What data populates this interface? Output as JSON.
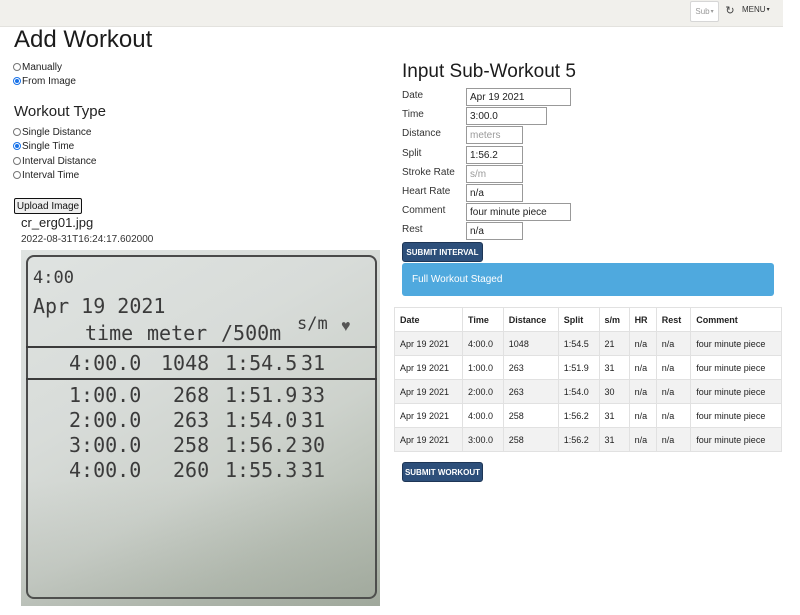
{
  "topbar": {
    "sub_dropdown": "Sub",
    "refresh_icon": "refresh-icon",
    "menu_label": "MENU"
  },
  "page": {
    "title": "Add Workout",
    "source_options": [
      {
        "label": "Manually",
        "selected": false
      },
      {
        "label": "From Image",
        "selected": true
      }
    ],
    "workout_type_heading": "Workout Type",
    "workout_types": [
      {
        "label": "Single Distance",
        "selected": false
      },
      {
        "label": "Single Time",
        "selected": true
      },
      {
        "label": "Interval Distance",
        "selected": false
      },
      {
        "label": "Interval Time",
        "selected": false
      }
    ],
    "upload_button": "Upload Image",
    "file_name": "cr_erg01.jpg",
    "file_timestamp": "2022-08-31T16:24:17.602000"
  },
  "erg_photo": {
    "top_time": "4:00",
    "date": "Apr  19 2021",
    "headers": [
      "time",
      "meter",
      "/500m",
      "s/m"
    ],
    "summary": [
      "4:00.0",
      "1048",
      "1:54.5",
      "31"
    ],
    "rows": [
      [
        "1:00.0",
        "268",
        "1:51.9",
        "33"
      ],
      [
        "2:00.0",
        "263",
        "1:54.0",
        "31"
      ],
      [
        "3:00.0",
        "258",
        "1:56.2",
        "30"
      ],
      [
        "4:00.0",
        "260",
        "1:55.3",
        "31"
      ]
    ]
  },
  "form": {
    "heading": "Input Sub-Workout 5",
    "fields": {
      "date": {
        "label": "Date",
        "value": "Apr 19 2021"
      },
      "time": {
        "label": "Time",
        "value": "3:00.0"
      },
      "distance": {
        "label": "Distance",
        "placeholder": "meters"
      },
      "split": {
        "label": "Split",
        "value": "1:56.2"
      },
      "stroke_rate": {
        "label": "Stroke Rate",
        "placeholder": "s/m"
      },
      "heart_rate": {
        "label": "Heart Rate",
        "value": "n/a"
      },
      "comment": {
        "label": "Comment",
        "value": "four minute piece"
      },
      "rest": {
        "label": "Rest",
        "value": "n/a"
      }
    },
    "submit_interval": "SUBMIT INTERVAL",
    "staged_message": "Full Workout Staged",
    "submit_workout": "SUBMIT WORKOUT"
  },
  "table": {
    "headers": [
      "Date",
      "Time",
      "Distance",
      "Split",
      "s/m",
      "HR",
      "Rest",
      "Comment"
    ],
    "rows": [
      [
        "Apr 19 2021",
        "4:00.0",
        "1048",
        "1:54.5",
        "21",
        "n/a",
        "n/a",
        "four minute piece"
      ],
      [
        "Apr 19 2021",
        "1:00.0",
        "263",
        "1:51.9",
        "31",
        "n/a",
        "n/a",
        "four minute piece"
      ],
      [
        "Apr 19 2021",
        "2:00.0",
        "263",
        "1:54.0",
        "30",
        "n/a",
        "n/a",
        "four minute piece"
      ],
      [
        "Apr 19 2021",
        "4:00.0",
        "258",
        "1:56.2",
        "31",
        "n/a",
        "n/a",
        "four minute piece"
      ],
      [
        "Apr 19 2021",
        "3:00.0",
        "258",
        "1:56.2",
        "31",
        "n/a",
        "n/a",
        "four minute piece"
      ]
    ]
  },
  "colors": {
    "button": "#2d4f7a",
    "alert": "#4fa9de",
    "topbar": "#f1f0ec"
  }
}
